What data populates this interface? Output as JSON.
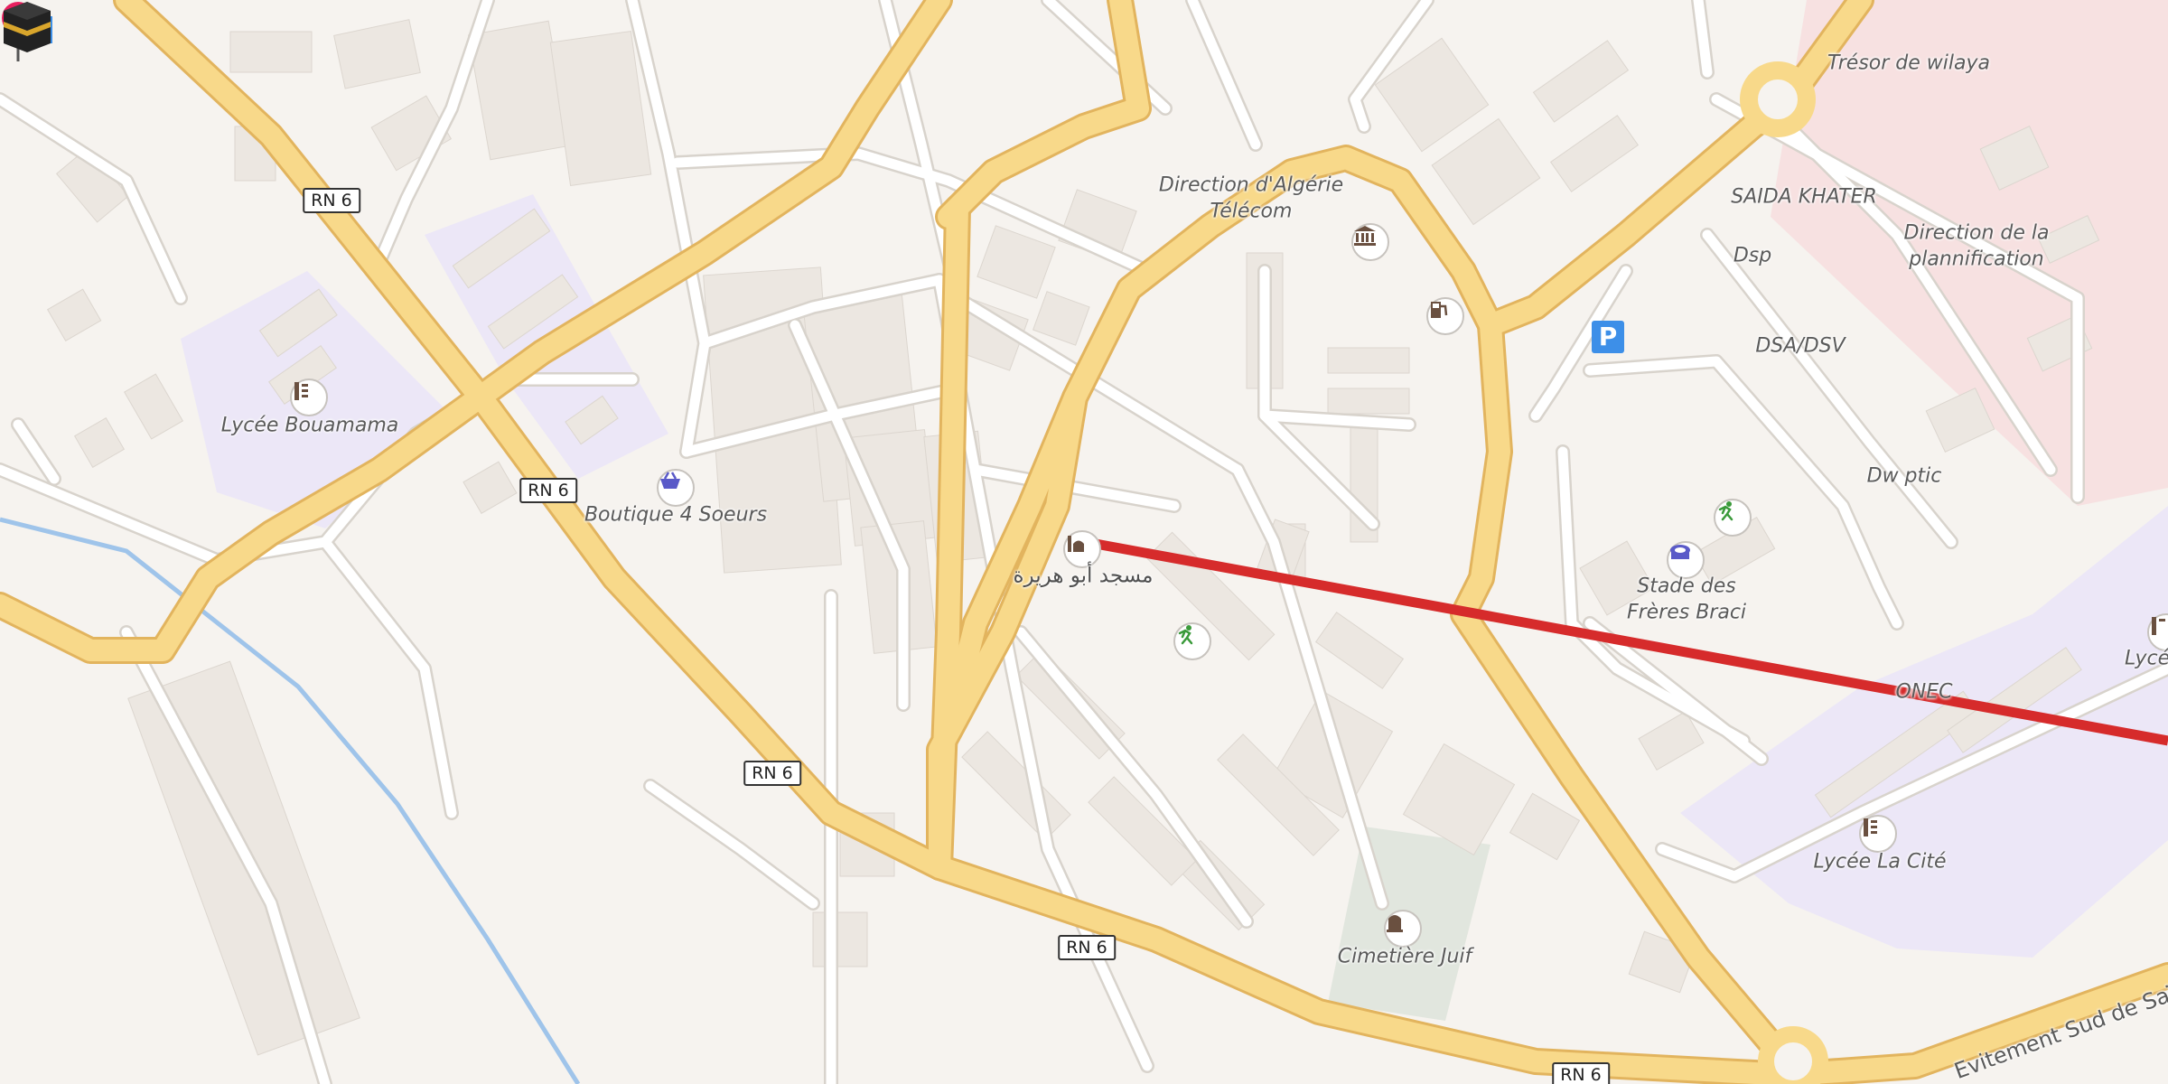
{
  "map": {
    "roads": {
      "rn6_1": "RN 6",
      "rn6_2": "RN 6",
      "rn6_3": "RN 6",
      "rn6_4": "RN 6",
      "rn6_5": "RN 6",
      "evitement": "Evitement Sud de Saïda"
    },
    "places": {
      "lycee_bouamama": "Lycée Bouamama",
      "boutique": "Boutique 4 Soeurs",
      "direction_algerie_telecom_1": "Direction d'Algérie",
      "direction_algerie_telecom_2": "Télécom",
      "tresor": "Trésor de wilaya",
      "saida_khater": "SAIDA KHATER",
      "dsp": "Dsp",
      "direction_plan_1": "Direction de la",
      "direction_plan_2": "plannification",
      "dsa_dsv": "DSA/DSV",
      "dw_ptic": "Dw ptic",
      "stade_1": "Stade des",
      "stade_2": "Frères Braci",
      "lycee_abde": "Lycée Abde",
      "onec": "ONEC",
      "lycee_la_cite": "Lycée La Cité",
      "cimetiere": "Cimetière Juif",
      "mosque": "مسجد أبو هريرة"
    },
    "icons": [
      "school-icon",
      "basket-icon",
      "bank-icon",
      "fuel-icon",
      "parking-icon",
      "stadium-icon",
      "sport-icon",
      "cemetery-icon",
      "mosque-icon",
      "kaaba-icon",
      "location-pin-icon"
    ],
    "colors": {
      "background": "#f6f3ef",
      "major_road": "#f8d98a",
      "school_area": "#ece7f7",
      "qibla_line": "#d62b2b",
      "pin": "#e8205f",
      "parking": "#3d8fe8"
    }
  }
}
